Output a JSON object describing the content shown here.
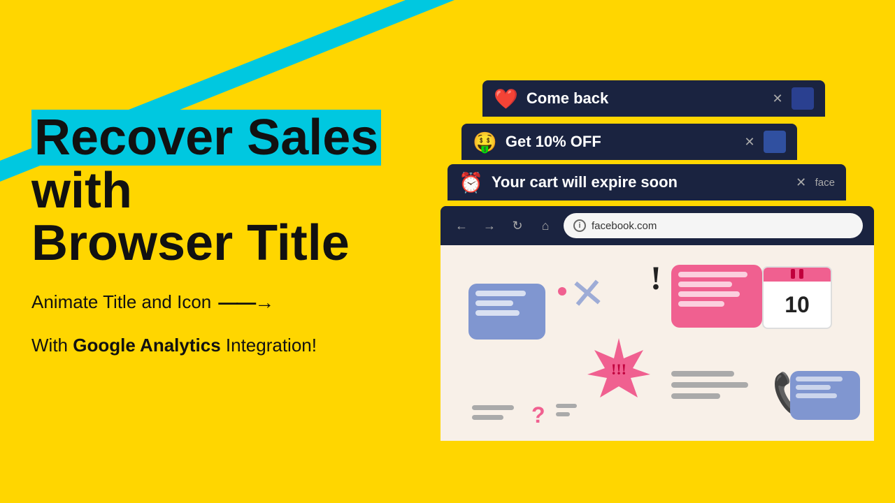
{
  "background": {
    "main_color": "#FFD600",
    "cyan_color": "#00C8E0",
    "dark_color": "#1a2340"
  },
  "left": {
    "headline_line1": "Recover Sales",
    "headline_highlight": "Recover Sales",
    "headline_line2": "with",
    "headline_line3": "Browser Title",
    "subtitle": "Animate Title and Icon",
    "arrow": "——→",
    "ga_line_pre": "With ",
    "ga_bold": "Google Analytics",
    "ga_line_post": " Integration!"
  },
  "notifications": [
    {
      "emoji": "❤️",
      "text": "Come back",
      "has_close": true,
      "has_favicon": true
    },
    {
      "emoji": "🤑",
      "text": "Get 10% OFF",
      "has_close": true,
      "has_favicon": true
    },
    {
      "emoji": "⏰",
      "text": "Your cart will expire soon",
      "has_close": true,
      "has_favicon": true,
      "favicon_text": "face"
    }
  ],
  "browser": {
    "url": "facebook.com",
    "nav_back": "←",
    "nav_forward": "→",
    "nav_refresh": "↻",
    "nav_home": "⌂",
    "info_icon": "i"
  },
  "illustration": {
    "calendar_number": "10"
  }
}
